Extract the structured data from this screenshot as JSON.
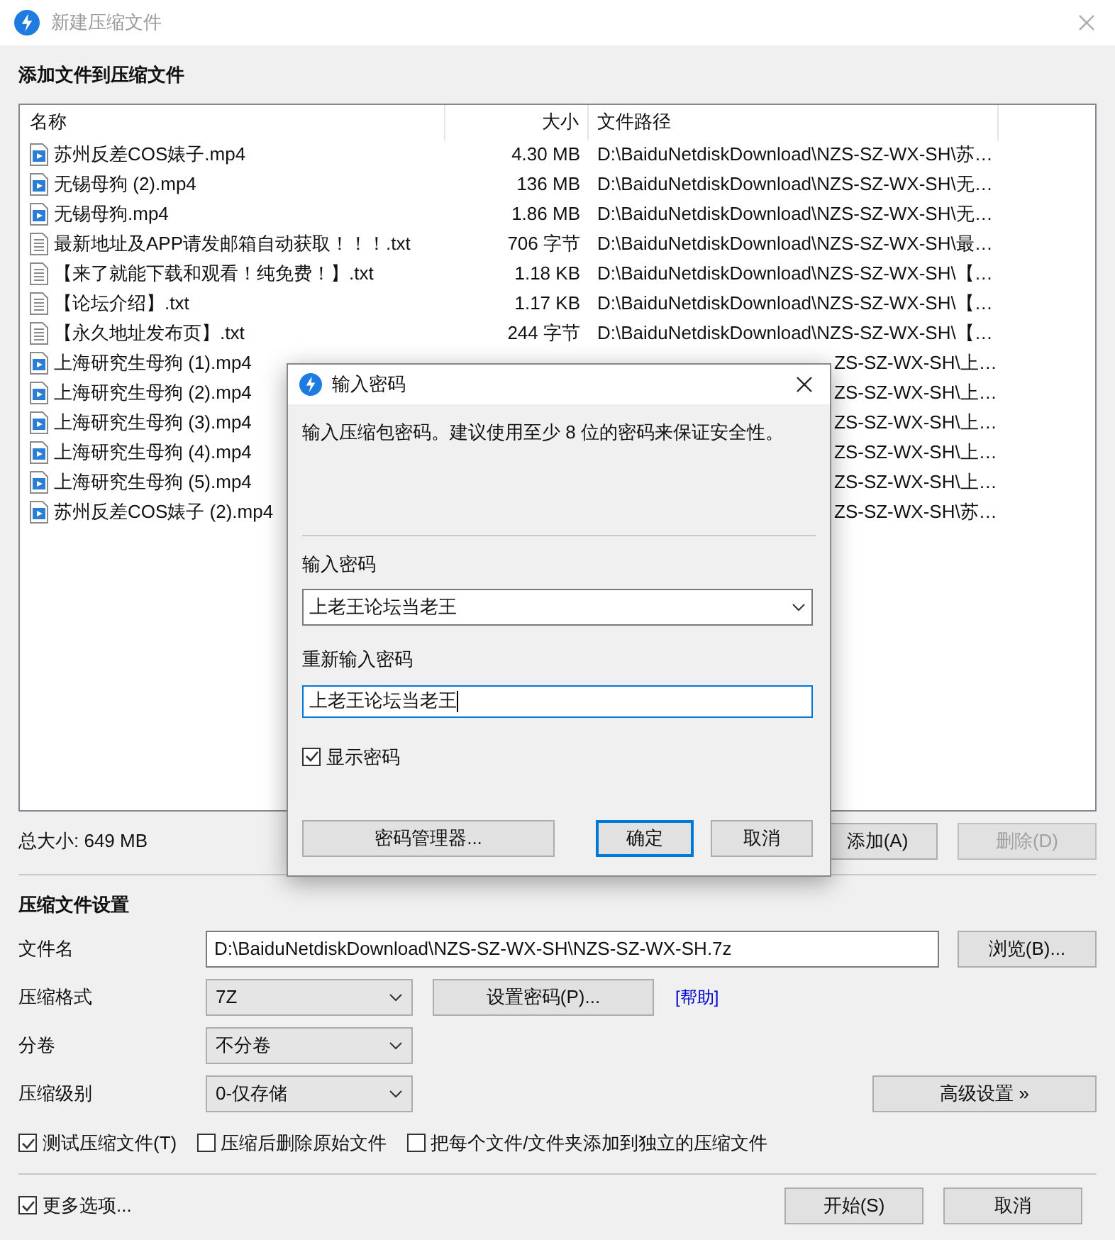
{
  "window": {
    "title": "新建压缩文件"
  },
  "files": {
    "heading": "添加文件到压缩文件",
    "columns": [
      "名称",
      "大小",
      "文件路径"
    ],
    "rows": [
      {
        "kind": "video",
        "name": "苏州反差COS婊子.mp4",
        "size": "4.30 MB",
        "path": "D:\\BaiduNetdiskDownload\\NZS-SZ-WX-SH\\苏…"
      },
      {
        "kind": "video",
        "name": "无锡母狗 (2).mp4",
        "size": "136 MB",
        "path": "D:\\BaiduNetdiskDownload\\NZS-SZ-WX-SH\\无…"
      },
      {
        "kind": "video",
        "name": "无锡母狗.mp4",
        "size": "1.86 MB",
        "path": "D:\\BaiduNetdiskDownload\\NZS-SZ-WX-SH\\无…"
      },
      {
        "kind": "text",
        "name": "最新地址及APP请发邮箱自动获取！！！.txt",
        "size": "706 字节",
        "path": "D:\\BaiduNetdiskDownload\\NZS-SZ-WX-SH\\最…"
      },
      {
        "kind": "text",
        "name": "【来了就能下载和观看！纯免费！】.txt",
        "size": "1.18 KB",
        "path": "D:\\BaiduNetdiskDownload\\NZS-SZ-WX-SH\\【…"
      },
      {
        "kind": "text",
        "name": "【论坛介绍】.txt",
        "size": "1.17 KB",
        "path": "D:\\BaiduNetdiskDownload\\NZS-SZ-WX-SH\\【…"
      },
      {
        "kind": "text",
        "name": "【永久地址发布页】.txt",
        "size": "244 字节",
        "path": "D:\\BaiduNetdiskDownload\\NZS-SZ-WX-SH\\【…"
      },
      {
        "kind": "video",
        "name": "上海研究生母狗 (1).mp4",
        "path": "ZS-SZ-WX-SH\\上…"
      },
      {
        "kind": "video",
        "name": "上海研究生母狗 (2).mp4",
        "path": "ZS-SZ-WX-SH\\上…"
      },
      {
        "kind": "video",
        "name": "上海研究生母狗 (3).mp4",
        "path": "ZS-SZ-WX-SH\\上…"
      },
      {
        "kind": "video",
        "name": "上海研究生母狗 (4).mp4",
        "path": "ZS-SZ-WX-SH\\上…"
      },
      {
        "kind": "video",
        "name": "上海研究生母狗 (5).mp4",
        "path": "ZS-SZ-WX-SH\\上…"
      },
      {
        "kind": "video",
        "name": "苏州反差COS婊子 (2).mp4",
        "path": "ZS-SZ-WX-SH\\苏…"
      }
    ],
    "total": "总大小: 649 MB",
    "buttons": [
      {
        "label": "添加(A)",
        "disabled": false
      },
      {
        "label": "删除(D)",
        "disabled": true
      }
    ]
  },
  "settings": {
    "heading": "压缩文件设置",
    "filename": {
      "label": "文件名",
      "value": "D:\\BaiduNetdiskDownload\\NZS-SZ-WX-SH\\NZS-SZ-WX-SH.7z"
    },
    "browse_button": "浏览(B)...",
    "format": {
      "label": "压缩格式",
      "value": "7Z"
    },
    "set_password_button": "设置密码(P)...",
    "help_link": "[帮助]",
    "volume": {
      "label": "分卷",
      "value": "不分卷"
    },
    "level": {
      "label": "压缩级别",
      "value": "0-仅存储"
    },
    "advanced_button": "高级设置 »",
    "options": [
      {
        "label": "测试压缩文件(T)",
        "checked": true
      },
      {
        "label": "压缩后删除原始文件",
        "checked": false
      },
      {
        "label": "把每个文件/文件夹添加到独立的压缩文件",
        "checked": false
      }
    ],
    "more_options": {
      "label": "更多选项...",
      "checked": true
    },
    "buttons": [
      {
        "label": "开始(S)"
      },
      {
        "label": "取消"
      }
    ]
  },
  "password_dialog": {
    "title": "输入密码",
    "description": "输入压缩包密码。建议使用至少 8 位的密码来保证安全性。",
    "password_label": "输入密码",
    "password_value": "上老王论坛当老王",
    "confirm_label": "重新输入密码",
    "confirm_value": "上老王论坛当老王",
    "show_password": {
      "label": "显示密码",
      "checked": true
    },
    "buttons": [
      {
        "label": "密码管理器...",
        "default": false
      },
      {
        "label": "确定",
        "default": true
      },
      {
        "label": "取消",
        "default": false
      }
    ]
  }
}
